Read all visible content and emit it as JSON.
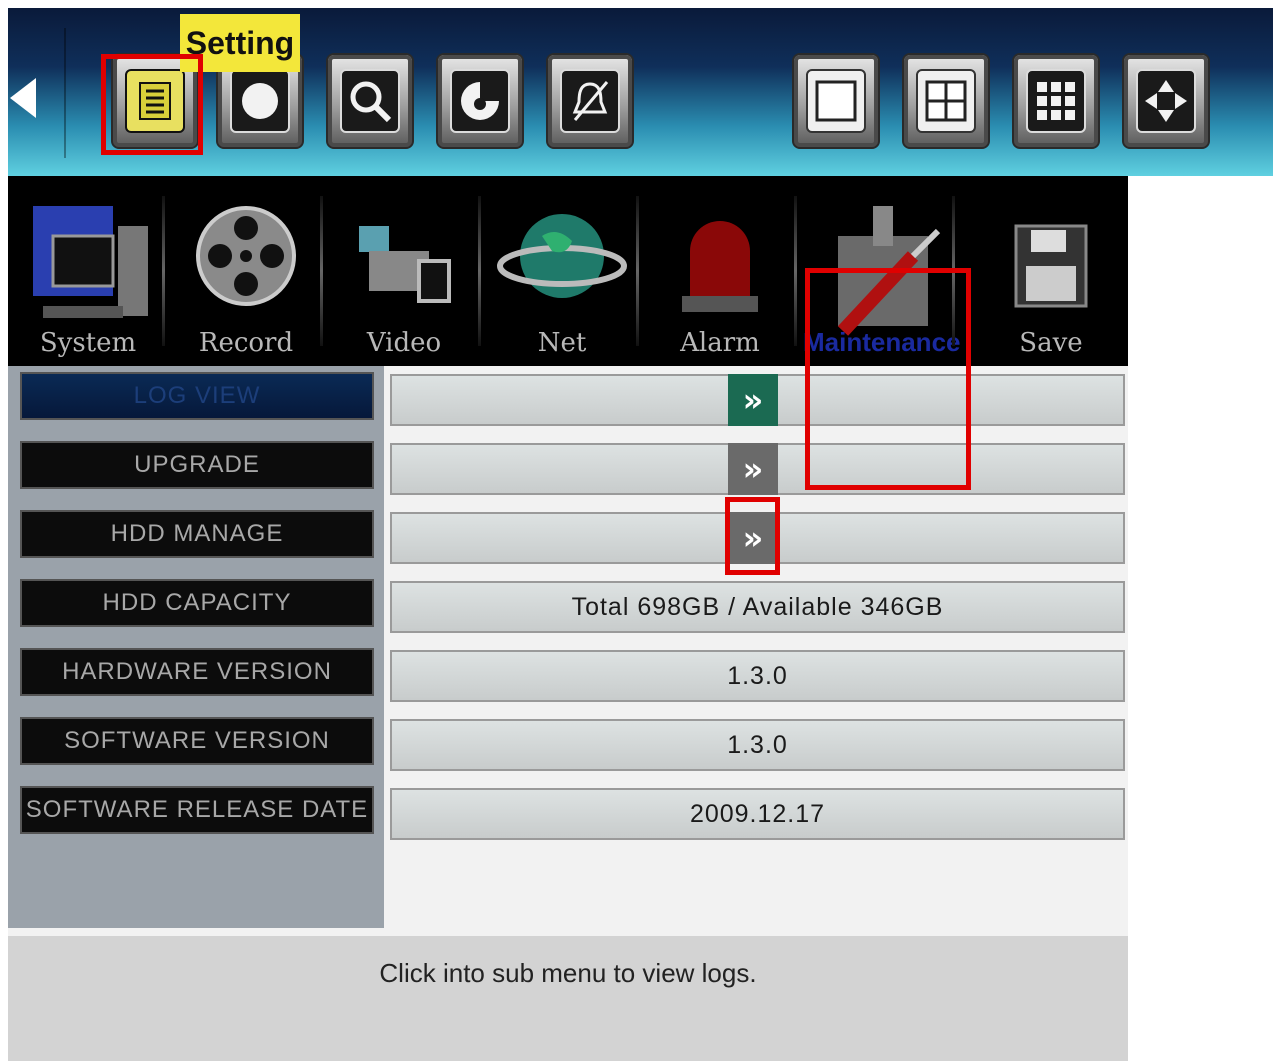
{
  "toolbar": {
    "tooltip": "Setting",
    "buttons": [
      {
        "name": "setting-icon"
      },
      {
        "name": "record-icon"
      },
      {
        "name": "search-icon"
      },
      {
        "name": "ptz-icon"
      },
      {
        "name": "alarm-mute-icon"
      },
      {
        "name": "single-view-icon"
      },
      {
        "name": "quad-view-icon"
      },
      {
        "name": "nine-view-icon"
      },
      {
        "name": "ptz-direction-icon"
      }
    ]
  },
  "categories": [
    {
      "label": "System",
      "icon": "computer-icon"
    },
    {
      "label": "Record",
      "icon": "film-reel-icon"
    },
    {
      "label": "Video",
      "icon": "camera-icon"
    },
    {
      "label": "Net",
      "icon": "globe-icon"
    },
    {
      "label": "Alarm",
      "icon": "siren-icon"
    },
    {
      "label": "Maintenance",
      "icon": "tools-icon",
      "active": true
    },
    {
      "label": "Save",
      "icon": "floppy-icon"
    }
  ],
  "rows": [
    {
      "label": "LOG VIEW",
      "value": "",
      "arrow": "»",
      "selected": true
    },
    {
      "label": "UPGRADE",
      "value": "",
      "arrow": "»"
    },
    {
      "label": "HDD MANAGE",
      "value": "",
      "arrow": "»"
    },
    {
      "label": "HDD CAPACITY",
      "value": "Total 698GB / Available 346GB"
    },
    {
      "label": "HARDWARE VERSION",
      "value": "1.3.0"
    },
    {
      "label": "SOFTWARE VERSION",
      "value": "1.3.0"
    },
    {
      "label": "SOFTWARE RELEASE DATE",
      "value": "2009.12.17"
    }
  ],
  "hint": "Click into sub menu to view logs.",
  "colors": {
    "annotation": "#e00000",
    "selected_arrow": "#1b6a52"
  }
}
